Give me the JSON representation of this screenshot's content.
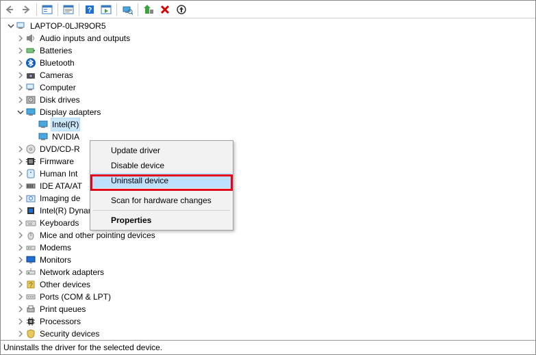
{
  "root": {
    "label": "LAPTOP-0LJR9OR5"
  },
  "categories": [
    {
      "label": "Audio inputs and outputs",
      "arrow": "right"
    },
    {
      "label": "Batteries",
      "arrow": "right"
    },
    {
      "label": "Bluetooth",
      "arrow": "right"
    },
    {
      "label": "Cameras",
      "arrow": "right"
    },
    {
      "label": "Computer",
      "arrow": "right"
    },
    {
      "label": "Disk drives",
      "arrow": "right"
    },
    {
      "label": "Display adapters",
      "arrow": "down",
      "children": [
        {
          "label": "Intel(R)",
          "selected": true
        },
        {
          "label": "NVIDIA"
        }
      ]
    },
    {
      "label": "DVD/CD-R",
      "arrow": "right"
    },
    {
      "label": "Firmware",
      "arrow": "right"
    },
    {
      "label": "Human Int",
      "arrow": "right"
    },
    {
      "label": "IDE ATA/AT",
      "arrow": "right"
    },
    {
      "label": "Imaging de",
      "arrow": "right"
    },
    {
      "label": "Intel(R) Dynamic Platform and Thermal Framework",
      "arrow": "right"
    },
    {
      "label": "Keyboards",
      "arrow": "right"
    },
    {
      "label": "Mice and other pointing devices",
      "arrow": "right"
    },
    {
      "label": "Modems",
      "arrow": "right"
    },
    {
      "label": "Monitors",
      "arrow": "right"
    },
    {
      "label": "Network adapters",
      "arrow": "right"
    },
    {
      "label": "Other devices",
      "arrow": "right"
    },
    {
      "label": "Ports (COM & LPT)",
      "arrow": "right"
    },
    {
      "label": "Print queues",
      "arrow": "right"
    },
    {
      "label": "Processors",
      "arrow": "right"
    },
    {
      "label": "Security devices",
      "arrow": "right"
    }
  ],
  "context_menu": {
    "items": [
      {
        "label": "Update driver"
      },
      {
        "label": "Disable device"
      },
      {
        "label": "Uninstall device",
        "highlight": true
      },
      {
        "sep": true
      },
      {
        "label": "Scan for hardware changes"
      },
      {
        "sep": true
      },
      {
        "label": "Properties",
        "bold": true
      }
    ]
  },
  "statusbar": {
    "text": "Uninstalls the driver for the selected device."
  },
  "icons": {
    "computer": "pc",
    "speaker": "spk",
    "battery": "bat",
    "bluetooth": "bt",
    "camera": "cam",
    "disk": "disk",
    "display": "disp",
    "dvd": "dvd",
    "firmware": "fw",
    "hid": "hid",
    "ide": "ide",
    "imaging": "img",
    "thermal": "thm",
    "keyboard": "kb",
    "mouse": "mouse",
    "modem": "mdm",
    "monitor": "mon",
    "network": "net",
    "other": "oth",
    "port": "port",
    "printer": "prn",
    "cpu": "cpu",
    "security": "sec"
  }
}
